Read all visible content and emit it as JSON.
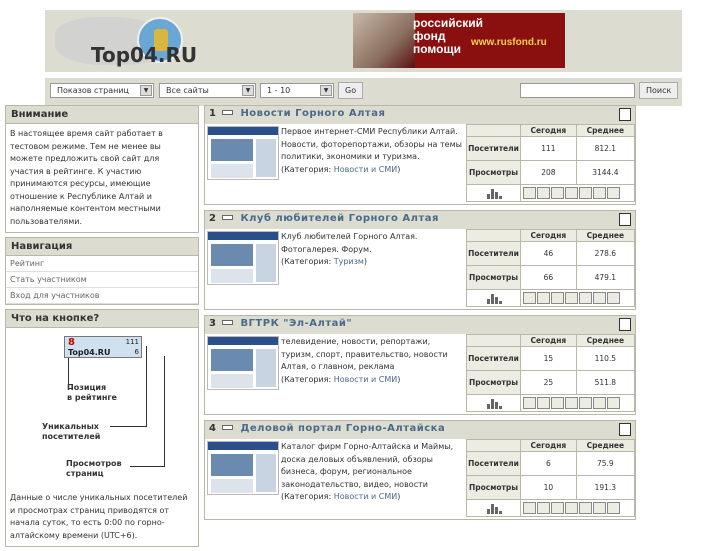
{
  "header": {
    "logo_text": "Top04.RU",
    "banner": {
      "title_line1": "российский",
      "title_line2": "фонд",
      "title_line3": "помощи",
      "url": "www.rusfond.ru"
    }
  },
  "toolbar": {
    "select_show": "Показов страниц",
    "select_sites": "Все сайты",
    "select_range": "1 - 10",
    "go_label": "Go",
    "search_value": "",
    "search_label": "Поиск"
  },
  "attention": {
    "title": "Внимание",
    "text": "В настоящее время сайт работает в тестовом режиме. Тем не менее вы можете предложить свой сайт для участия в рейтинге. К участию принимаются ресурсы, имеющие отношение к Республике Алтай и наполняемые контентом местными пользователями."
  },
  "navigation": {
    "title": "Навигация",
    "items": [
      "Рейтинг",
      "Стать участником",
      "Вход для участников"
    ]
  },
  "button_legend": {
    "title": "Что на кнопке?",
    "badge_pos": "8",
    "badge_name": "Top04.RU",
    "badge_num1": "111",
    "badge_num2": "6",
    "label_position_1": "Позиция",
    "label_position_2": "в рейтинге",
    "label_unique_1": "Уникальных",
    "label_unique_2": "посетителей",
    "label_views_1": "Просмотров",
    "label_views_2": "страниц",
    "note": "Данные о числе уникальных посетителей и просмотрах страниц приводятся от начала суток, то есть 0:00 по горно-алтайскому времени (UTC+6)."
  },
  "stats_headers": {
    "today": "Сегодня",
    "average": "Среднее",
    "visitors": "Посетители",
    "views": "Просмотры"
  },
  "category_prefix": "(Категория: ",
  "category_suffix": ")",
  "sites": [
    {
      "rank": "1",
      "title": "Новости Горного Алтая",
      "description": "Первое интернет-СМИ Республики Алтай. Новости, фоторепортажи, обзоры на темы политики, экономики и туризма.",
      "category": "Новости и СМИ",
      "visitors_today": "111",
      "visitors_avg": "812.1",
      "views_today": "208",
      "views_avg": "3144.4"
    },
    {
      "rank": "2",
      "title": "Клуб любителей Горного Алтая",
      "description": "Клуб любителей Горного Алтая. Фотогалерея. Форум.",
      "category": "Туризм",
      "visitors_today": "46",
      "visitors_avg": "278.6",
      "views_today": "66",
      "views_avg": "479.1"
    },
    {
      "rank": "3",
      "title": "ВГТРК \"Эл-Алтай\"",
      "description": "телевидение, новости, репортажи, туризм, спорт, правительство, новости Алтая, о главном, реклама",
      "category": "Новости и СМИ",
      "visitors_today": "15",
      "visitors_avg": "110.5",
      "views_today": "25",
      "views_avg": "511.8"
    },
    {
      "rank": "4",
      "title": "Деловой портал Горно-Алтайска",
      "description": "Каталог фирм Горно-Алтайска и Маймы, доска деловых объявлений, обзоры бизнеса, форум, региональное законодательство, видео, новости",
      "category": "Новости и СМИ",
      "visitors_today": "6",
      "visitors_avg": "75.9",
      "views_today": "10",
      "views_avg": "191.3"
    }
  ]
}
